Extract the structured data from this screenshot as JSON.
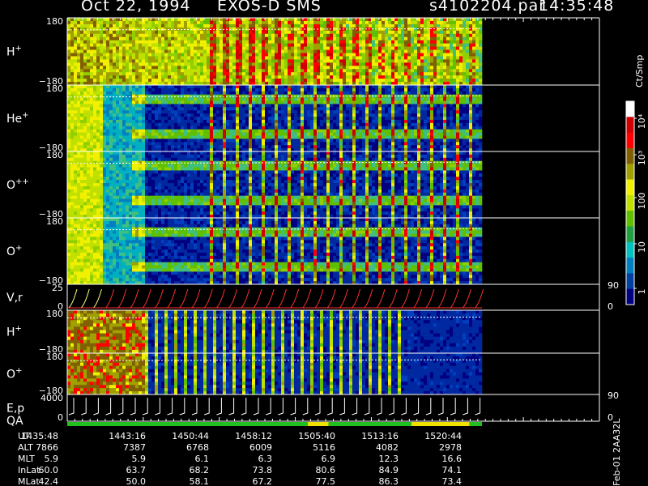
{
  "title": {
    "date": "Oct 22, 1994",
    "instrument": "EXOS-D SMS",
    "file": "s4102204.par",
    "time": "14:35:48"
  },
  "panels": [
    {
      "label": "H",
      "sup": "+",
      "ymax": "180",
      "ymin": "−180"
    },
    {
      "label": "He",
      "sup": "+",
      "ymax": "180",
      "ymin": "−180"
    },
    {
      "label": "O",
      "sup": "++",
      "ymax": "180",
      "ymin": "−180"
    },
    {
      "label": "O",
      "sup": "+",
      "ymax": "180",
      "ymin": "−180"
    },
    {
      "label": "V,r",
      "sup": "",
      "ymax": "25",
      "ymin": "0",
      "rmax": "90",
      "rmin": "0"
    },
    {
      "label": "H",
      "sup": "+",
      "ymax": "180",
      "ymin": "−180"
    },
    {
      "label": "O",
      "sup": "+",
      "ymax": "180",
      "ymin": "−180"
    },
    {
      "label": "E,p",
      "sup": "",
      "ymax": "4000",
      "ymin": "0",
      "rmax": "90",
      "rmin": "0",
      "extra": "QA"
    }
  ],
  "colorbar": {
    "unit": "Ct/Smp",
    "ticks": [
      "10⁴",
      "10³",
      "100",
      "10",
      "1"
    ],
    "colors": [
      "#ffffff",
      "#d00000",
      "#ff0000",
      "#806000",
      "#a0a000",
      "#f0f000",
      "#c0e000",
      "#60c000",
      "#20a040",
      "#00c0c0",
      "#0080c0",
      "#0040a0",
      "#000080"
    ]
  },
  "footer": {
    "rows": [
      {
        "name": "UT",
        "values": [
          "1435:48",
          "1443:16",
          "1450:44",
          "1458:12",
          "1505:40",
          "1513:16",
          "1520:44"
        ]
      },
      {
        "name": "ALT",
        "values": [
          "7866",
          "7387",
          "6768",
          "6009",
          "5116",
          "4082",
          "2978"
        ]
      },
      {
        "name": "MLT",
        "values": [
          "5.9",
          "5.9",
          "6.1",
          "6.3",
          "6.9",
          "12.3",
          "16.6"
        ]
      },
      {
        "name": "InLat",
        "values": [
          "60.0",
          "63.7",
          "68.2",
          "73.8",
          "80.6",
          "84.9",
          "74.1"
        ]
      },
      {
        "name": "MLat",
        "values": [
          "42.4",
          "50.0",
          "58.1",
          "67.2",
          "77.5",
          "86.3",
          "73.4"
        ]
      }
    ],
    "stamp": "Feb-01 2AA32L"
  },
  "chart_data": {
    "type": "heatmap",
    "title": "Oct 22, 1994   EXOS-D SMS",
    "x_ticks": [
      "1435:48",
      "1443:16",
      "1450:44",
      "1458:12",
      "1505:40",
      "1513:16",
      "1520:44"
    ],
    "color_scale": "log",
    "clim": [
      1,
      10000
    ],
    "colorbar_label": "Ct/Smp",
    "panels": [
      "H+",
      "He+",
      "O++",
      "O+",
      "V,r",
      "H+",
      "O+",
      "E,p"
    ]
  }
}
